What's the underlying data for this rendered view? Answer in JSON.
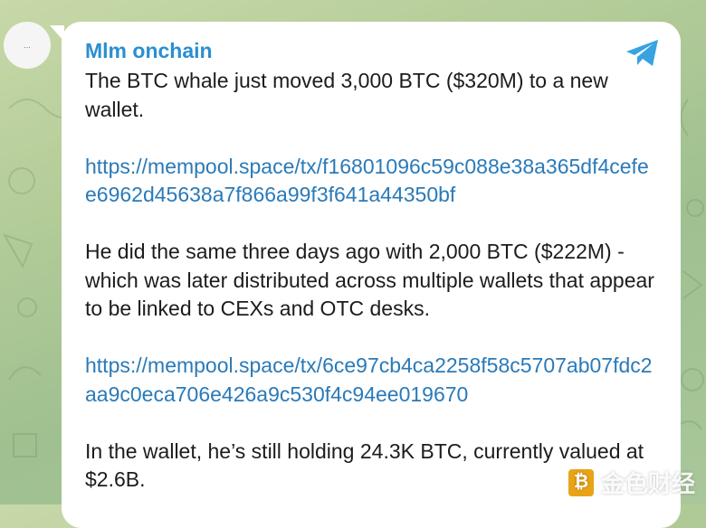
{
  "avatar": {
    "label": "..."
  },
  "message": {
    "sender": "Mlm onchain",
    "paragraphs": [
      "The BTC whale just moved 3,000 BTC ($320M) to a new wallet.",
      "He did the same three days ago with 2,000 BTC ($222M) - which was later distributed across multiple wallets that appear to be linked to CEXs and OTC desks.",
      "In the wallet, he’s still holding 24.3K BTC, currently valued at $2.6B."
    ],
    "links": [
      "https://mempool.space/tx/f16801096c59c088e38a365df4cefee6962d45638a7f866a99f3f641a44350bf",
      "https://mempool.space/tx/6ce97cb4ca2258f58c5707ab07fdc2aa9c0eca706e426a9c530f4c94ee019670"
    ]
  },
  "watermark": {
    "text": "金色财经",
    "logo_glyph": "₿"
  },
  "colors": {
    "sender": "#2a8fd0",
    "link": "#2a7ab8",
    "telegram_icon": "#37a3e0"
  },
  "icons": {
    "share": "telegram-plane-icon"
  }
}
